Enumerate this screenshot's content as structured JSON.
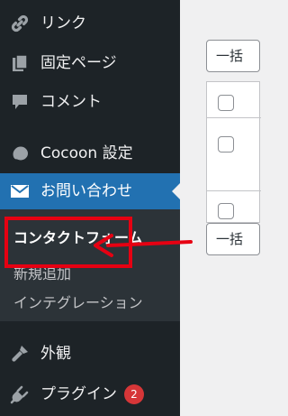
{
  "sidebar": {
    "items": [
      {
        "label": "リンク",
        "icon": "link-icon"
      },
      {
        "label": "固定ページ",
        "icon": "page-icon"
      },
      {
        "label": "コメント",
        "icon": "comment-icon"
      },
      {
        "label": "Cocoon 設定",
        "icon": "cocoon-icon"
      },
      {
        "label": "お問い合わせ",
        "icon": "mail-icon",
        "active": true
      },
      {
        "label": "外観",
        "icon": "appearance-icon"
      },
      {
        "label": "プラグイン",
        "icon": "plugin-icon",
        "badge": "2"
      }
    ],
    "submenu": {
      "header": "コンタクトフォーム",
      "items": [
        "新規追加",
        "インテグレーション"
      ]
    }
  },
  "content": {
    "bulk_action_top": "一括",
    "bulk_action_bottom": "一括"
  },
  "colors": {
    "sidebar_bg": "#1d2327",
    "submenu_bg": "#2c3338",
    "active_bg": "#2271b1",
    "highlight": "#e60012",
    "badge": "#d63638"
  }
}
